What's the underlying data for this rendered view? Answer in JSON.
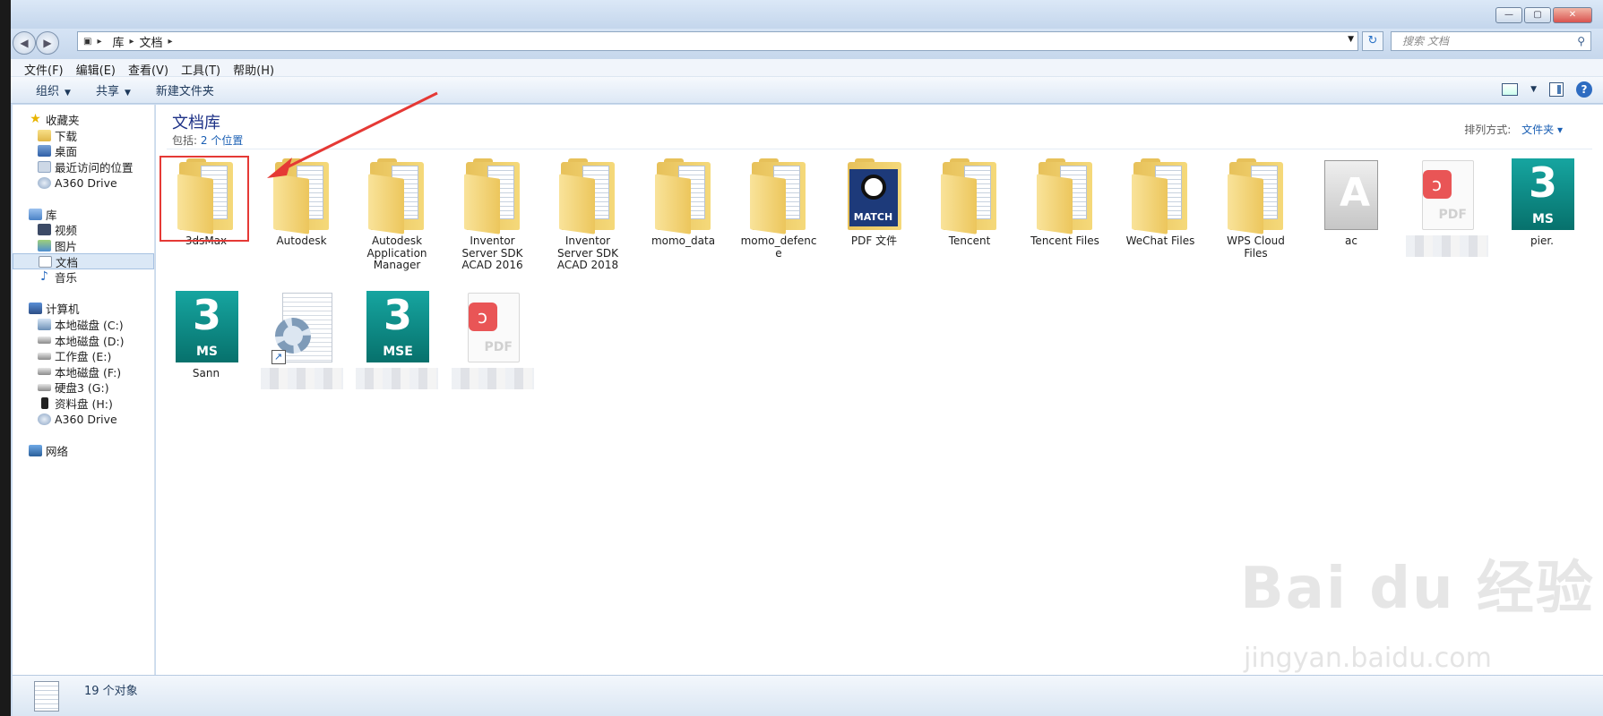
{
  "window": {
    "controls": [
      "—",
      "▢",
      "✕"
    ]
  },
  "address": {
    "back_glyph": "◀",
    "forward_glyph": "▶",
    "crumbs": [
      "库",
      "文档"
    ],
    "refresh_glyph": "↻",
    "search_placeholder": "搜索 文档"
  },
  "menu": [
    "文件(F)",
    "编辑(E)",
    "查看(V)",
    "工具(T)",
    "帮助(H)"
  ],
  "commands": {
    "organize": "组织",
    "share": "共享",
    "new_folder": "新建文件夹",
    "help": "?"
  },
  "sidebar": {
    "favorites": {
      "label": "收藏夹",
      "items": [
        "下载",
        "桌面",
        "最近访问的位置",
        "A360 Drive"
      ]
    },
    "libraries": {
      "label": "库",
      "items": [
        "视频",
        "图片",
        "文档",
        "音乐"
      ],
      "selected": "文档"
    },
    "computer": {
      "label": "计算机",
      "items": [
        "本地磁盘 (C:)",
        "本地磁盘 (D:)",
        "工作盘 (E:)",
        "本地磁盘 (F:)",
        "硬盘3 (G:)",
        "资料盘 (H:)",
        "A360 Drive"
      ]
    },
    "network": {
      "label": "网络"
    }
  },
  "library": {
    "title": "文档库",
    "includes_label": "包括:",
    "includes_link": "2 个位置",
    "arrange_label": "排列方式:",
    "arrange_value": "文件夹 ▾"
  },
  "items": [
    {
      "label": "3dsMax",
      "type": "folder"
    },
    {
      "label": "Autodesk",
      "type": "folder"
    },
    {
      "label": "Autodesk Application Manager",
      "type": "folder"
    },
    {
      "label": "Inventor Server SDK ACAD 2016",
      "type": "folder"
    },
    {
      "label": "Inventor Server SDK ACAD 2018",
      "type": "folder"
    },
    {
      "label": "momo_data",
      "type": "folder"
    },
    {
      "label": "momo_defence",
      "type": "folder"
    },
    {
      "label": "PDF 文件",
      "type": "match",
      "badge": "MATCH"
    },
    {
      "label": "Tencent",
      "type": "folder"
    },
    {
      "label": "Tencent Files",
      "type": "folder"
    },
    {
      "label": "WeChat Files",
      "type": "folder"
    },
    {
      "label": "WPS Cloud Files",
      "type": "folder"
    },
    {
      "label": "ac",
      "type": "acad"
    },
    {
      "label": "",
      "type": "pdf",
      "badge_text": "PDF"
    },
    {
      "label": "pier.",
      "type": "max",
      "badge": "MS",
      "num": "3"
    },
    {
      "label": "Sann",
      "type": "max",
      "badge": "MS",
      "num": "3"
    },
    {
      "label": "",
      "type": "config"
    },
    {
      "label": "",
      "type": "max",
      "badge": "MSE",
      "num": "3"
    },
    {
      "label": "",
      "type": "pdf",
      "badge_text": "PDF"
    }
  ],
  "status": {
    "count": "19 个对象"
  },
  "watermark": {
    "brand": "Bai du 经验",
    "url": "jingyan.baidu.com"
  }
}
